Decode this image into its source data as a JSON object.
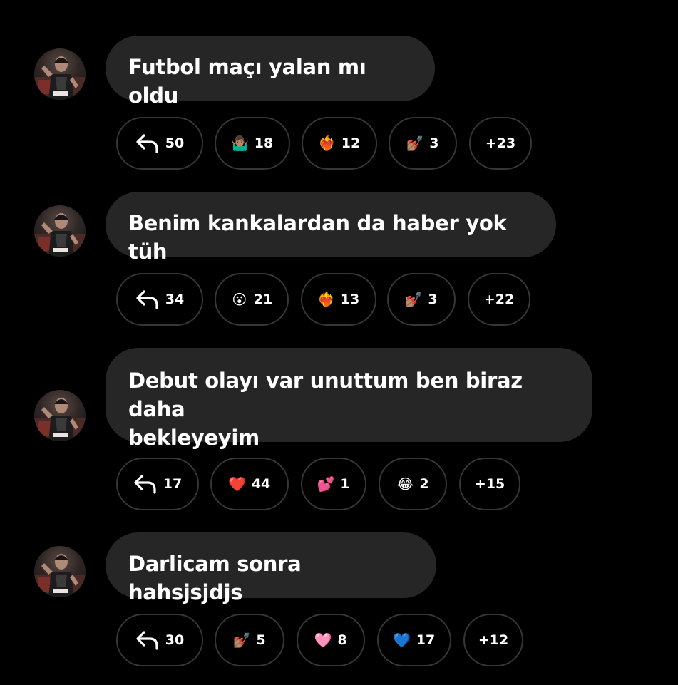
{
  "colors": {
    "background": "#000000",
    "bubble": "#262626",
    "pill_border": "#363636",
    "text": "#ffffff"
  },
  "messages": [
    {
      "text": "Futbol maçı yalan mı oldu",
      "reactions": [
        {
          "type": "reply",
          "icon": "reply-arrow-icon",
          "count": "50"
        },
        {
          "type": "emoji",
          "icon": "person-shrugging-icon",
          "emoji": "🤷🏽‍♂️",
          "count": "18"
        },
        {
          "type": "emoji",
          "icon": "heart-on-fire-icon",
          "emoji": "❤️‍🔥",
          "count": "12"
        },
        {
          "type": "emoji",
          "icon": "nail-polish-icon",
          "emoji": "💅🏽",
          "count": "3"
        },
        {
          "type": "more",
          "count": "+23"
        }
      ]
    },
    {
      "text": "Benim kankalardan da haber yok tüh",
      "reactions": [
        {
          "type": "reply",
          "icon": "reply-arrow-icon",
          "count": "34"
        },
        {
          "type": "emoji",
          "icon": "astonished-face-icon",
          "emoji": "😮",
          "count": "21"
        },
        {
          "type": "emoji",
          "icon": "heart-on-fire-icon",
          "emoji": "❤️‍🔥",
          "count": "13"
        },
        {
          "type": "emoji",
          "icon": "nail-polish-icon",
          "emoji": "💅🏽",
          "count": "3"
        },
        {
          "type": "more",
          "count": "+22"
        }
      ]
    },
    {
      "text_lines": [
        "Debut olayı var unuttum ben biraz daha",
        "bekleyeyim"
      ],
      "reactions": [
        {
          "type": "reply",
          "icon": "reply-arrow-icon",
          "count": "17"
        },
        {
          "type": "emoji",
          "icon": "red-heart-icon",
          "emoji": "❤️",
          "count": "44"
        },
        {
          "type": "emoji",
          "icon": "two-hearts-icon",
          "emoji": "💕",
          "count": "1"
        },
        {
          "type": "emoji",
          "icon": "tears-of-joy-icon",
          "emoji": "😂",
          "count": "2"
        },
        {
          "type": "more",
          "count": "+15"
        }
      ]
    },
    {
      "text": "Darlicam sonra hahsjsjdjs",
      "reactions": [
        {
          "type": "reply",
          "icon": "reply-arrow-icon",
          "count": "30"
        },
        {
          "type": "emoji",
          "icon": "nail-polish-icon",
          "emoji": "💅🏽",
          "count": "5"
        },
        {
          "type": "emoji",
          "icon": "pink-heart-icon",
          "emoji": "🩷",
          "count": "8"
        },
        {
          "type": "emoji",
          "icon": "blue-heart-icon",
          "emoji": "💙",
          "count": "17"
        },
        {
          "type": "more",
          "count": "+12"
        }
      ]
    }
  ]
}
